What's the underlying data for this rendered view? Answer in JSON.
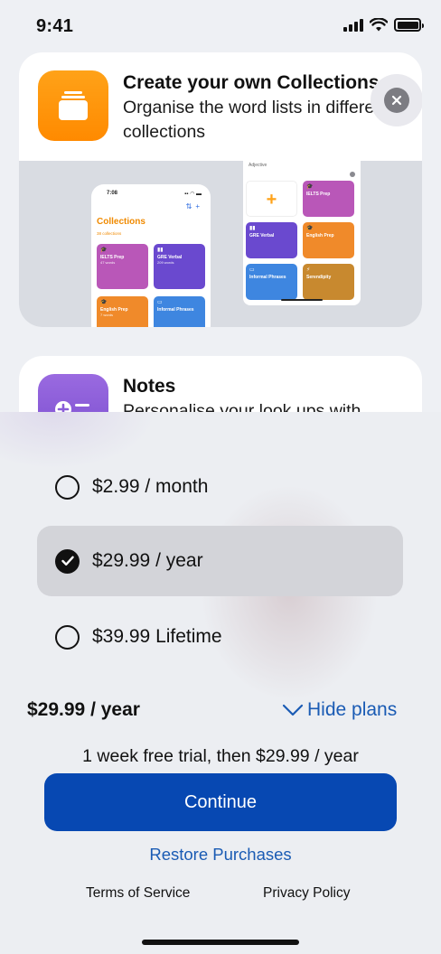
{
  "status_bar": {
    "time": "9:41"
  },
  "features": [
    {
      "title": "Create your own Collections",
      "description": "Organise the word lists in different collections",
      "preview": {
        "phone_time": "7:08",
        "phone_title": "Collections",
        "phone_subtitle": "38 collections",
        "tiles": [
          {
            "title": "IELTS Prep",
            "sub": "47 words",
            "color": "#b957b8"
          },
          {
            "title": "GRE Verbal",
            "sub": "209 words",
            "color": "#6a49cf"
          },
          {
            "title": "English Prep",
            "sub": "7 words",
            "color": "#f08a2a"
          },
          {
            "title": "Informal Phrases",
            "sub": "",
            "color": "#3e86e0"
          }
        ],
        "panel_label": "Adjective",
        "panel_tiles": [
          {
            "title": "+",
            "color": "#ffffff"
          },
          {
            "title": "IELTS Prep",
            "color": "#b957b8"
          },
          {
            "title": "GRE Verbal",
            "color": "#6a49cf"
          },
          {
            "title": "English Prep",
            "color": "#f08a2a"
          },
          {
            "title": "Informal Phrases",
            "color": "#3e86e0"
          },
          {
            "title": "Serendipity",
            "color": "#c8892f"
          }
        ]
      }
    },
    {
      "title": "Notes",
      "description": "Personalise your look ups with"
    }
  ],
  "plans": [
    {
      "label": "$2.99 / month",
      "selected": false
    },
    {
      "label": "$29.99 / year",
      "selected": true
    },
    {
      "label": "$39.99 Lifetime",
      "selected": false
    }
  ],
  "summary": {
    "price": "$29.99 / year",
    "toggle_label": "Hide plans",
    "trial_text": "1 week free trial, then $29.99 / year"
  },
  "actions": {
    "continue": "Continue",
    "restore": "Restore Purchases",
    "terms": "Terms of Service",
    "privacy": "Privacy Policy"
  },
  "colors": {
    "accent": "#0748b2",
    "link": "#1a5bb4",
    "collections_icon": "#ff9500",
    "notes_icon": "#8a5cd8"
  }
}
